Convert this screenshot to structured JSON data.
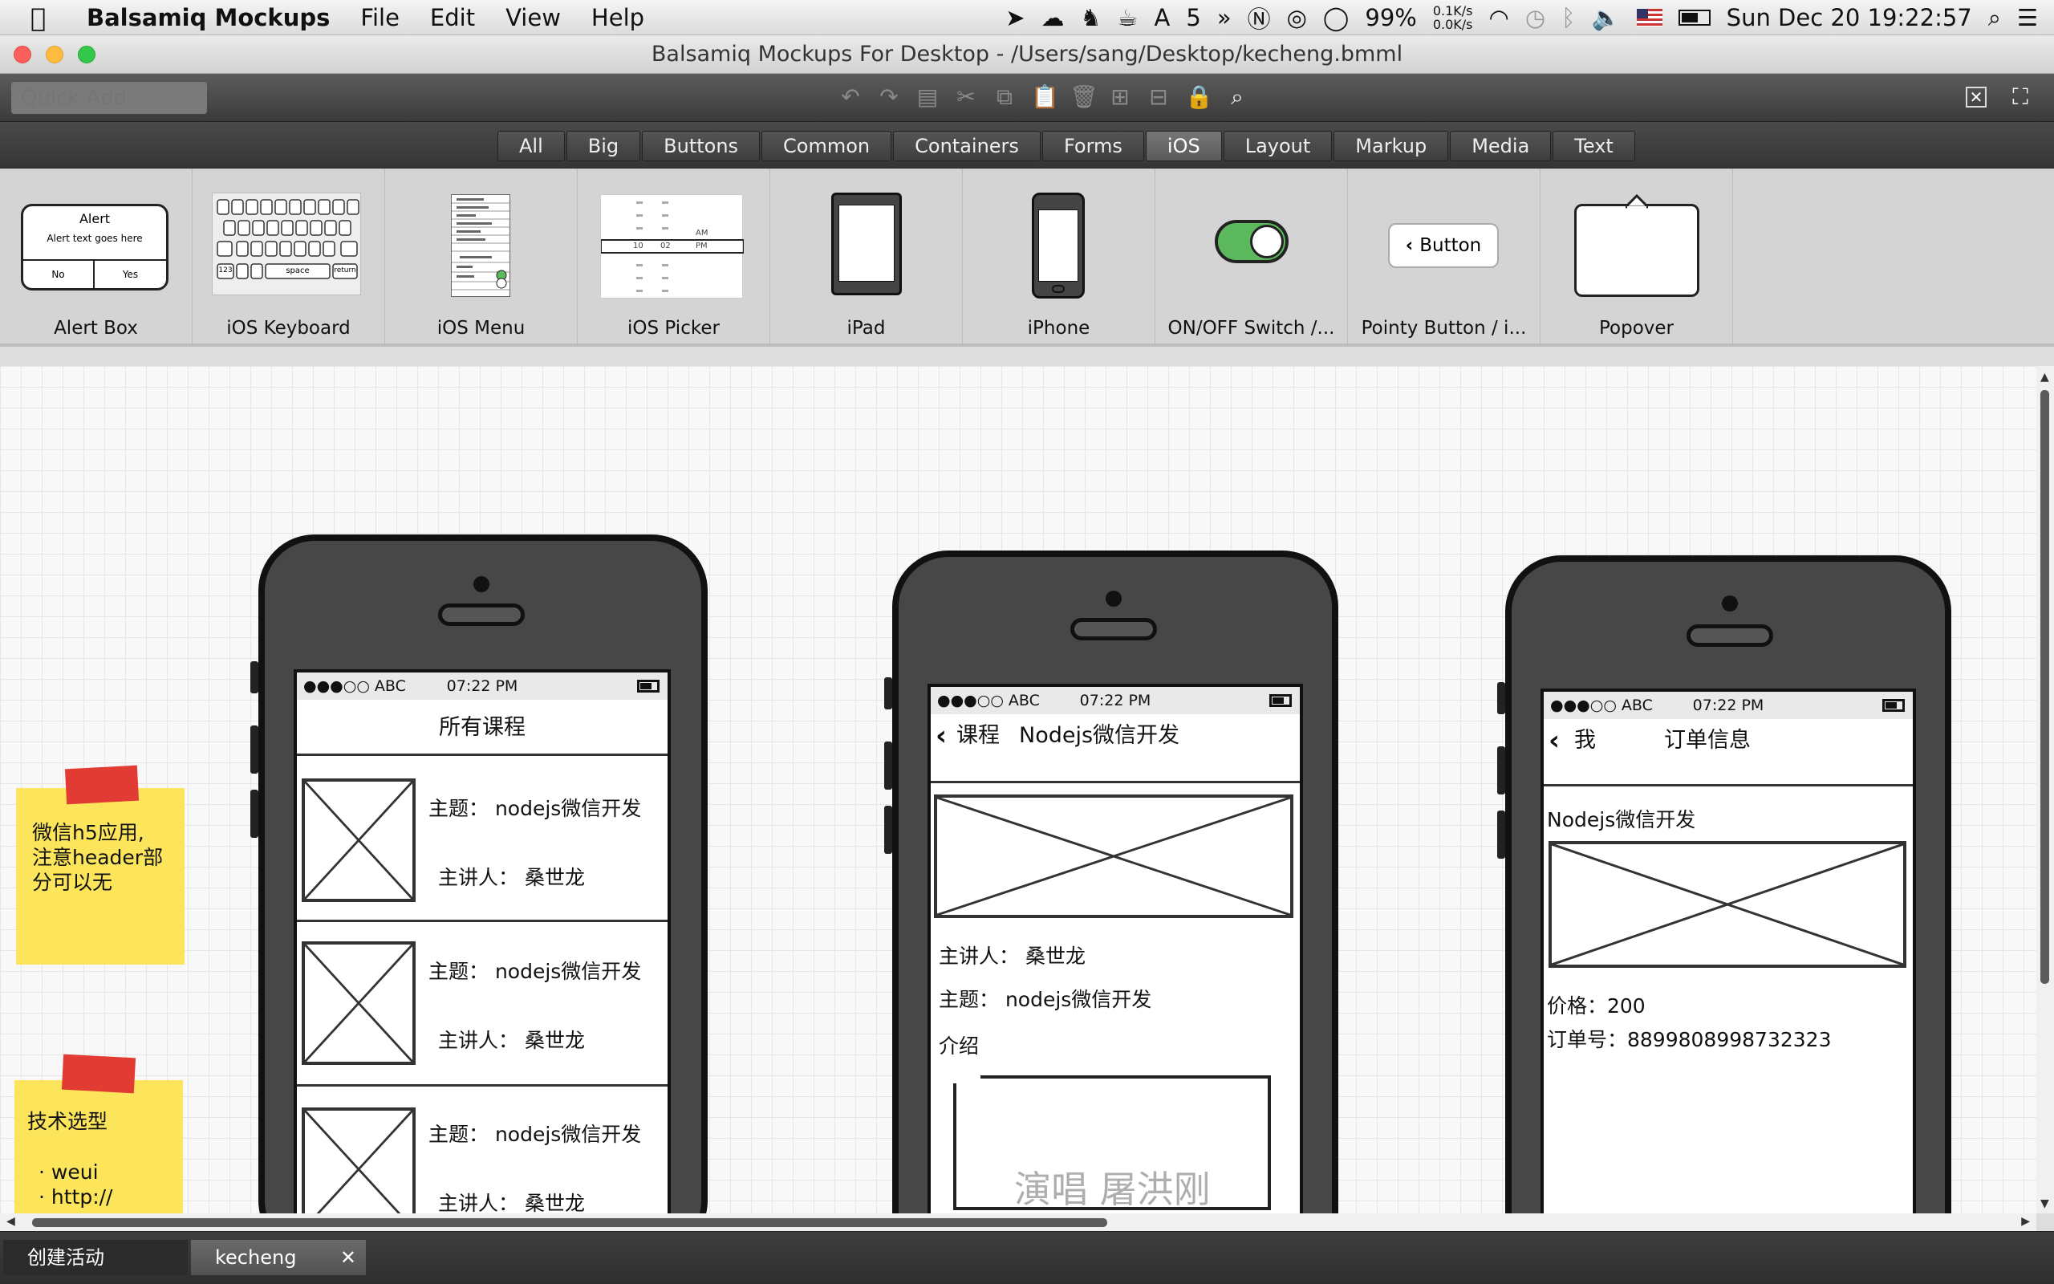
{
  "menubar": {
    "app_name": "Balsamiq Mockups",
    "menus": [
      "File",
      "Edit",
      "View",
      "Help"
    ],
    "status": {
      "icon_number": "5",
      "battery_percent": "99%",
      "net_up": "0.1K/s",
      "net_down": "0.0K/s",
      "datetime": "Sun Dec 20  19:22:57"
    }
  },
  "window": {
    "title": "Balsamiq Mockups For Desktop - /Users/sang/Desktop/kecheng.bmml"
  },
  "toolbar": {
    "quick_add_placeholder": "Quick Add"
  },
  "categories": [
    "All",
    "Big",
    "Buttons",
    "Common",
    "Containers",
    "Forms",
    "iOS",
    "Layout",
    "Markup",
    "Media",
    "Text"
  ],
  "active_category": "iOS",
  "library": [
    {
      "label": "Alert Box",
      "icon": "alert-box-thumb",
      "alert_title": "Alert",
      "alert_text": "Alert text goes here",
      "btn_no": "No",
      "btn_yes": "Yes"
    },
    {
      "label": "iOS Keyboard",
      "icon": "keyboard-thumb",
      "space": "space",
      "return": "return",
      "num": "123"
    },
    {
      "label": "iOS Menu",
      "icon": "ios-menu-thumb"
    },
    {
      "label": "iOS Picker",
      "icon": "ios-picker-thumb",
      "am": "AM",
      "pm": "PM",
      "sel_hour": "10",
      "sel_min": "02"
    },
    {
      "label": "iPad",
      "icon": "ipad-thumb"
    },
    {
      "label": "iPhone",
      "icon": "iphone-thumb"
    },
    {
      "label": "ON/OFF Switch /...",
      "icon": "switch-thumb"
    },
    {
      "label": "Pointy Button / i...",
      "icon": "pointy-button-thumb",
      "button_text": "Button"
    },
    {
      "label": "Popover",
      "icon": "popover-thumb"
    }
  ],
  "status_common": {
    "carrier": "●●●○○ ABC",
    "time": "07:22 PM"
  },
  "phone1": {
    "title": "所有课程",
    "rows": [
      {
        "topic": "主题：  nodejs微信开发",
        "speaker": "主讲人：  桑世龙"
      },
      {
        "topic": "主题：  nodejs微信开发",
        "speaker": "主讲人：  桑世龙"
      },
      {
        "topic": "主题：  nodejs微信开发",
        "speaker": "主讲人：  桑世龙"
      }
    ]
  },
  "phone2": {
    "back": "课程",
    "title": "Nodejs微信开发",
    "speaker": "主讲人：  桑世龙",
    "topic": "主题：  nodejs微信开发",
    "intro": "介绍"
  },
  "phone3": {
    "back": "我",
    "title": "订单信息",
    "course": "Nodejs微信开发",
    "price": "价格：200",
    "order_no": "订单号：8899808998732323"
  },
  "notes": [
    {
      "lines": [
        "微信h5应用,",
        "注意header部",
        "分可以无"
      ]
    },
    {
      "title": "技术选型",
      "items": [
        "·    weui",
        "·    http://"
      ]
    }
  ],
  "watermark": "演唱  屠洪刚",
  "tabs": [
    {
      "label": "创建活动"
    },
    {
      "label": "kecheng",
      "close": "✕"
    }
  ],
  "colors": {
    "switch_on": "#5cb85c",
    "note_yellow": "#fce55a",
    "tape_red": "#e23b34"
  }
}
